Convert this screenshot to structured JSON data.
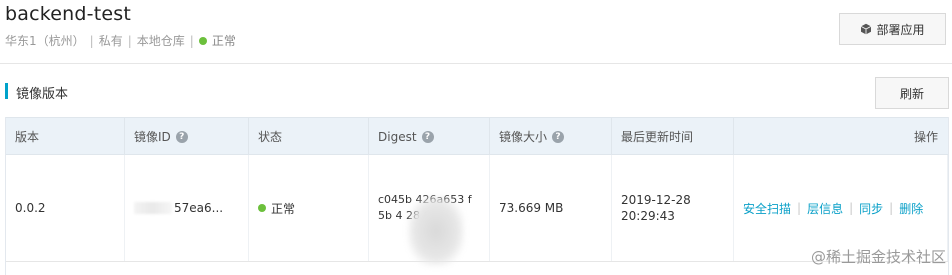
{
  "header": {
    "title": "backend-test",
    "meta": [
      "华东1（杭州）",
      "私有",
      "本地仓库"
    ],
    "status": "正常",
    "deploy_label": "部署应用"
  },
  "section": {
    "title": "镜像版本",
    "refresh_label": "刷新"
  },
  "table": {
    "columns": [
      "版本",
      "镜像ID",
      "状态",
      "Digest",
      "镜像大小",
      "最后更新时间",
      "操作"
    ],
    "rows": [
      {
        "version": "0.0.2",
        "image_id": "57ea6...",
        "status": "正常",
        "digest": "c045b     426a653     f5b     4    28 6",
        "size": "73.669 MB",
        "updated_date": "2019-12-28",
        "updated_time": "20:29:43",
        "actions": [
          "安全扫描",
          "层信息",
          "同步",
          "删除"
        ]
      }
    ]
  },
  "watermark": "@稀土掘金技术社区",
  "colors": {
    "accent": "#00a2ca",
    "link": "#0aa0c8",
    "status_ok": "#6cc03c",
    "table_header_bg": "#ebf2f8"
  }
}
